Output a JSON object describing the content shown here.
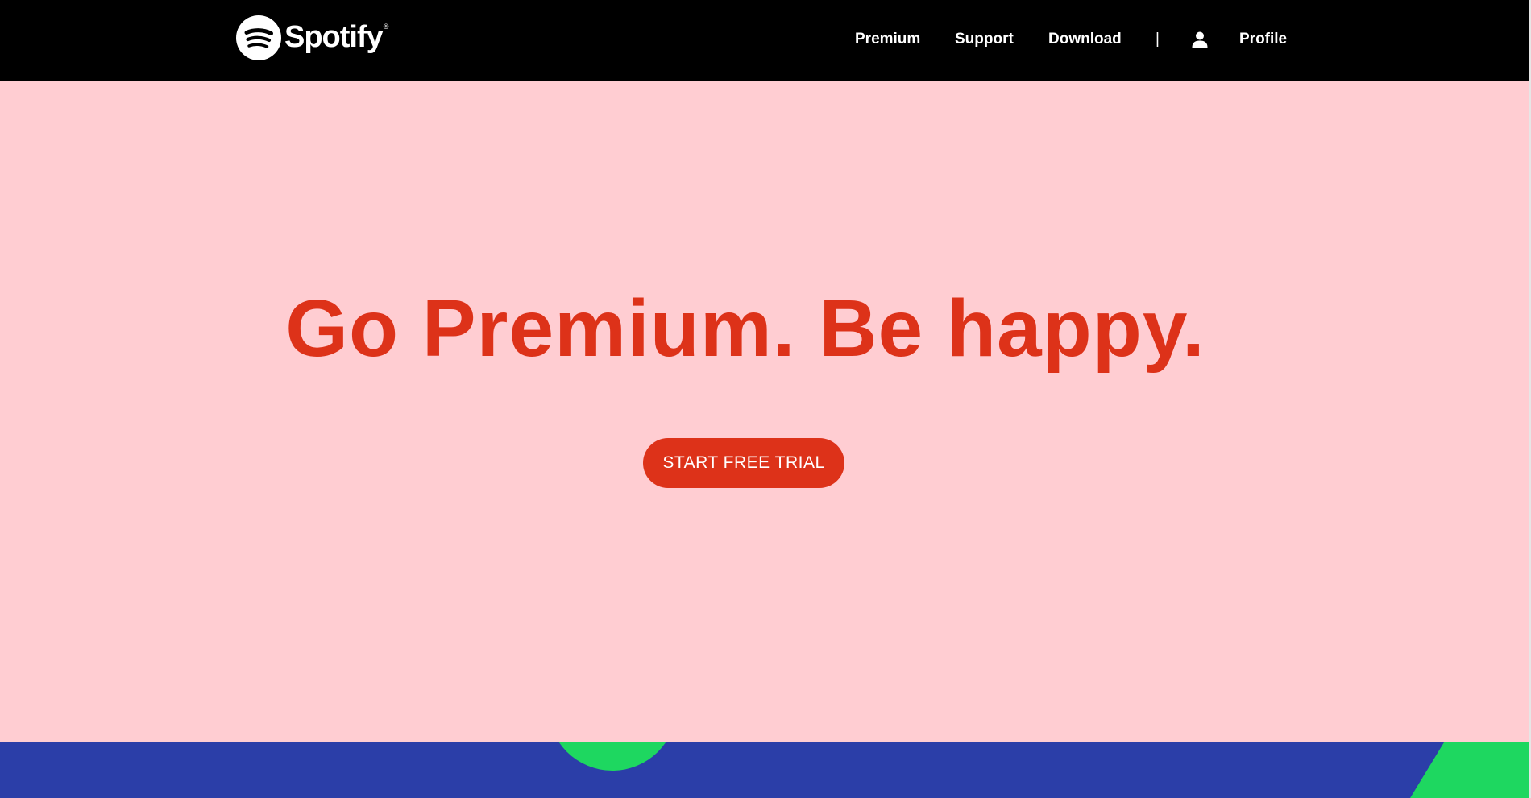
{
  "header": {
    "brand": {
      "name": "Spotify",
      "registered_mark": "®",
      "logo_icon": "spotify-sound-waves-icon"
    },
    "nav": {
      "premium": "Premium",
      "support": "Support",
      "download": "Download",
      "divider": "|",
      "profile_icon": "user-icon",
      "profile": "Profile"
    }
  },
  "hero": {
    "title": "Go Premium. Be happy.",
    "cta_label": "START FREE TRIAL"
  },
  "colors": {
    "header_bg": "#000000",
    "hero_bg": "#ffcdd2",
    "accent_red": "#dd3219",
    "band_blue": "#2b3ea8",
    "brand_green": "#1ed760",
    "text_white": "#ffffff"
  }
}
